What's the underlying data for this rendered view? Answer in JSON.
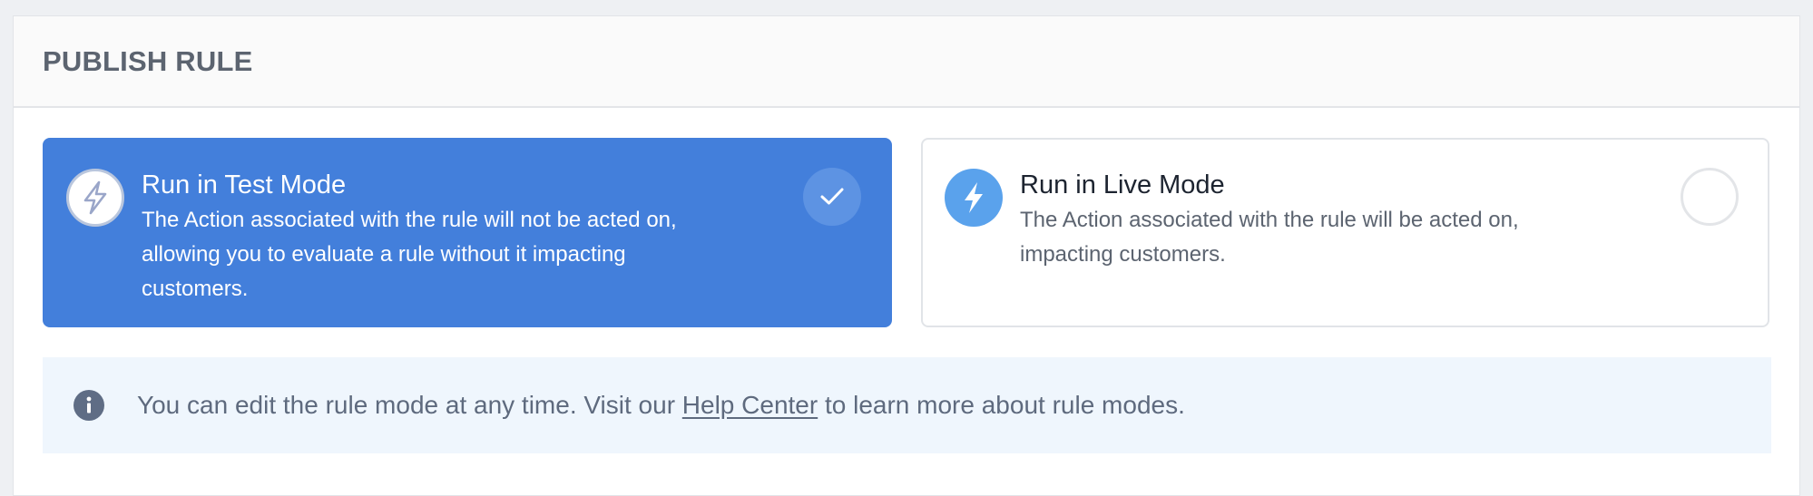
{
  "panel": {
    "title": "PUBLISH RULE"
  },
  "options": [
    {
      "title": "Run in Test Mode",
      "description": "The Action associated with the rule will not be acted on, allowing you to evaluate a rule without it impacting customers.",
      "selected": true,
      "icon": "lightning-outline-icon"
    },
    {
      "title": "Run in Live Mode",
      "description": "The Action associated with the rule will be acted on, impacting customers.",
      "selected": false,
      "icon": "lightning-filled-icon"
    }
  ],
  "info": {
    "text_before": "You can edit the rule mode at any time. Visit our ",
    "link_text": "Help Center",
    "text_after": " to learn more about rule modes.",
    "icon": "info-icon"
  },
  "colors": {
    "selected_bg": "#437fdb",
    "live_icon_bg": "#5aa2ec",
    "info_bg": "#eff6fd",
    "text_muted": "#5c6470"
  }
}
